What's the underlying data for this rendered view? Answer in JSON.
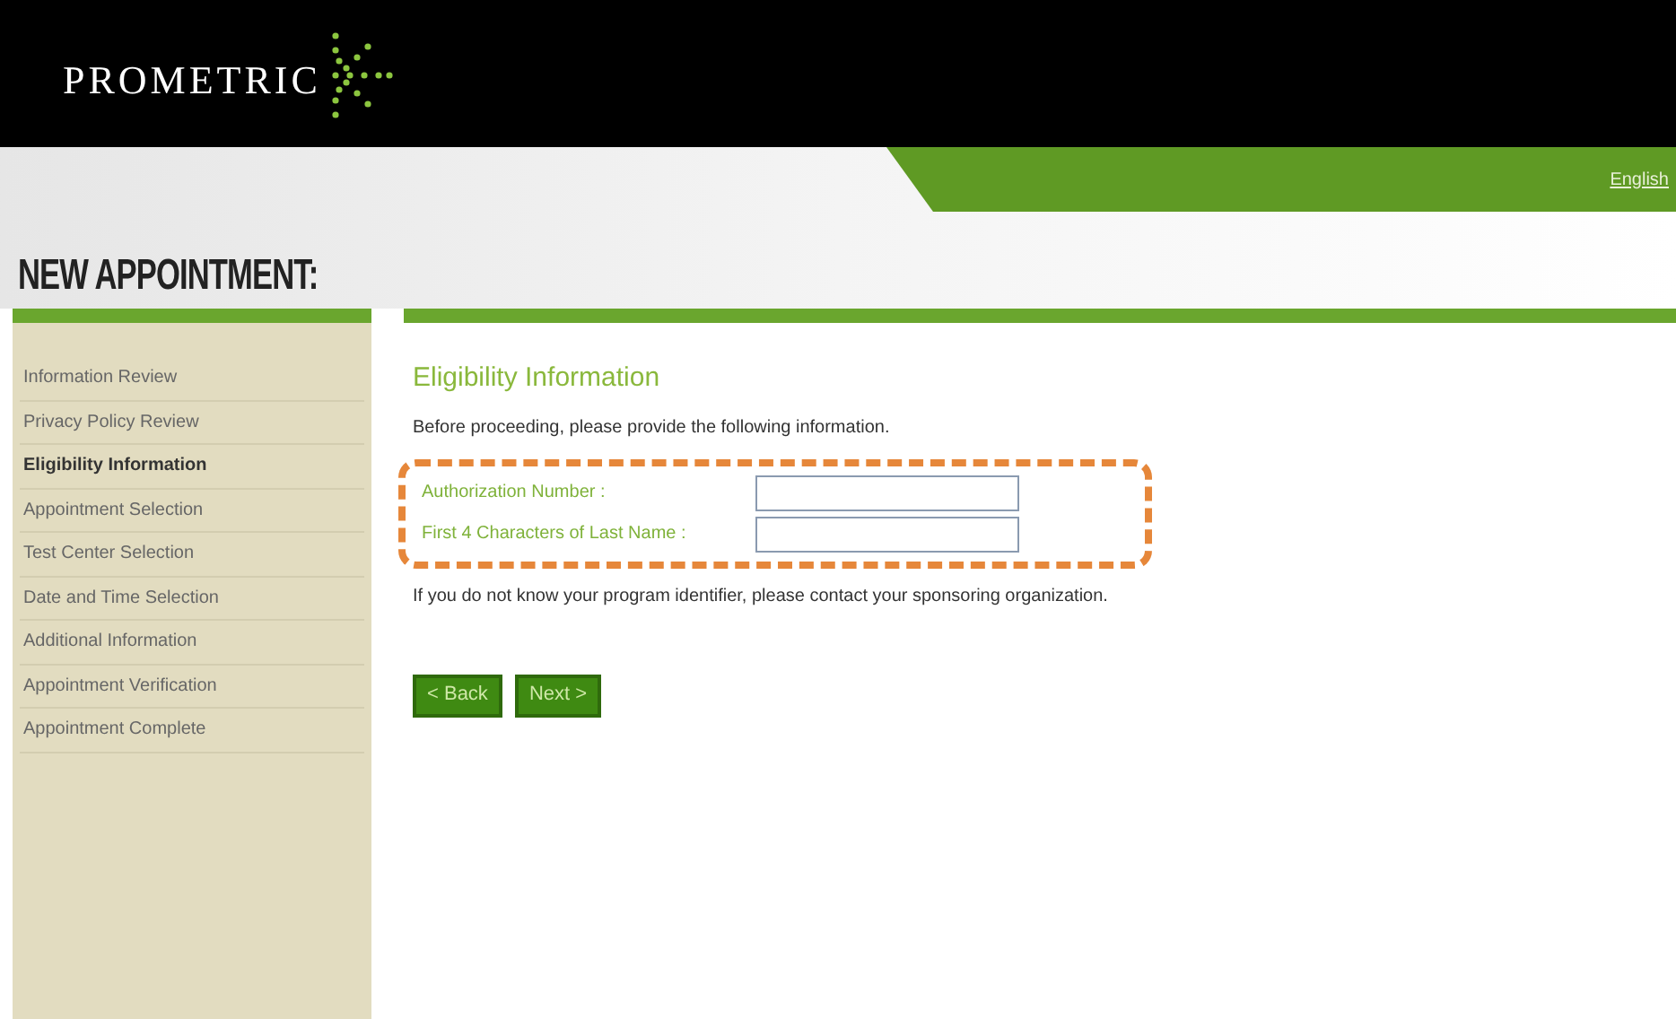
{
  "header": {
    "logo": "PROMETRIC",
    "language_link": "English"
  },
  "page_title": "NEW APPOINTMENT:",
  "sidebar": {
    "items": [
      {
        "label": "Information Review",
        "selected": false
      },
      {
        "label": "Privacy Policy Review",
        "selected": false
      },
      {
        "label": "Eligibility Information",
        "selected": true
      },
      {
        "label": "Appointment Selection",
        "selected": false
      },
      {
        "label": "Test Center Selection",
        "selected": false
      },
      {
        "label": "Date and Time Selection",
        "selected": false
      },
      {
        "label": "Additional Information",
        "selected": false
      },
      {
        "label": "Appointment Verification",
        "selected": false
      },
      {
        "label": "Appointment Complete",
        "selected": false
      }
    ]
  },
  "content": {
    "heading": "Eligibility Information",
    "intro": "Before proceeding, please provide the following information.",
    "fields": [
      {
        "label": "Authorization Number :"
      },
      {
        "label": "First 4 Characters of Last Name :"
      }
    ],
    "note": "If you do not know your program identifier, please contact your sponsoring organization.",
    "buttons": [
      "< Back",
      "Next >"
    ]
  }
}
